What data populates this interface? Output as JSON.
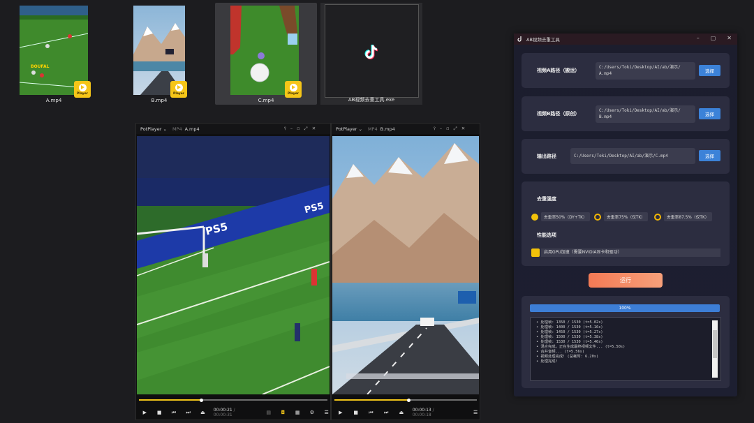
{
  "desktop_files": [
    {
      "name": "A.mp4",
      "badge": "Player"
    },
    {
      "name": "B.mp4",
      "badge": "Player"
    },
    {
      "name": "C.mp4",
      "badge": "Player"
    },
    {
      "name": "AB视频去重工具.exe"
    }
  ],
  "thumb_texts": {
    "boufal": "BOUFAL"
  },
  "player_a": {
    "brand": "PotPlayer ⌄",
    "format": "MP4",
    "filename": "A.mp4",
    "time_current": "00:00:21",
    "time_total": "/ 00:00:31",
    "progress": 0.33
  },
  "player_b": {
    "brand": "PotPlayer ⌄",
    "format": "MP4",
    "filename": "B.mp4",
    "time_current": "00:00:13",
    "time_total": "/ 00:00:18",
    "progress": 0.52
  },
  "field_texts": {
    "ps5": "PS5"
  },
  "tool": {
    "title": "AB视频去重工具",
    "video_a_label": "视频A路径（搬运）",
    "video_a_path_1": "C:/Users/Toki/Desktop/AI/ab/演示/",
    "video_a_path_2": "A.mp4",
    "video_b_label": "视频B路径（原创）",
    "video_b_path_1": "C:/Users/Toki/Desktop/AI/ab/演示/",
    "video_b_path_2": "B.mp4",
    "output_label": "输出路径",
    "output_path": "C:/Users/Toki/Desktop/AI/ab/演示/C.mp4",
    "choose_label": "选择",
    "strength_label": "去重强度",
    "options": [
      "去重率50%（DY+TK）",
      "去重率75%（仅TK）",
      "去重率87.5%（仅TK）"
    ],
    "selected_option": 0,
    "perf_label": "性能选项",
    "gpu_label": "启用GPU加速（需要NVIDIA显卡和驱动）",
    "gpu_enabled": true,
    "run_label": "运行",
    "progress_text": "100%",
    "progress": 1.0,
    "log_lines": [
      "• 处理帧: 1350 / 1530 (t=5.02s)",
      "• 处理帧: 1400 / 1530 (t=5.16s)",
      "• 处理帧: 1450 / 1530 (t=5.27s)",
      "• 处理帧: 1500 / 1530 (t=5.38s)",
      "• 处理帧: 1530 / 1530 (t=5.46s)",
      "• 混合完成，正在生成最终视频文件... (t=5.50s)",
      "• 合并音频... (t=5.56s)",
      "• 视频处理完成! (总耗时: 6.20s)",
      "• 处理完成!"
    ]
  },
  "colors": {
    "accent_yellow": "#f5c518",
    "button_blue": "#3c82d8",
    "run_orange": "#f37a55",
    "tool_bg": "#1c1d2d",
    "card_bg": "#2c2d40"
  }
}
